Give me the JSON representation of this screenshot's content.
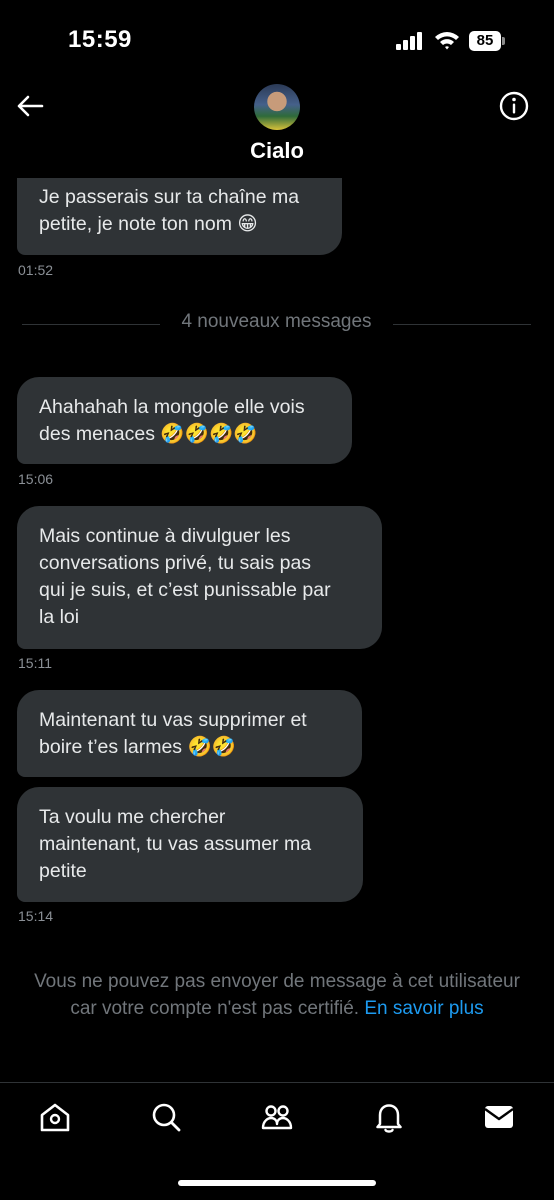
{
  "status_bar": {
    "time": "15:59",
    "battery_level": "85"
  },
  "header": {
    "contact_name": "Cialo"
  },
  "thread": {
    "messages": [
      {
        "lines": [
          "Je passerais sur ta chaîne ma",
          "petite, je note ton nom 😁"
        ],
        "timestamp": "01:52"
      },
      {
        "lines": [
          "Ahahahah la mongole elle vois",
          "des menaces 🤣🤣🤣🤣"
        ],
        "timestamp": "15:06"
      },
      {
        "lines": [
          "Mais continue à divulguer les",
          "conversations privé, tu sais pas",
          "qui je suis, et c’est punissable par",
          "la loi"
        ],
        "timestamp": "15:11"
      },
      {
        "lines": [
          "Maintenant tu vas supprimer et",
          "boire t’es larmes 🤣🤣"
        ]
      },
      {
        "lines": [
          "Ta voulu me chercher",
          "maintenant, tu vas assumer ma",
          "petite"
        ],
        "timestamp": "15:14"
      }
    ],
    "new_messages_divider": "4 nouveaux messages"
  },
  "notice": {
    "line1": "Vous ne pouvez pas envoyer de message à cet utilisateur",
    "line2": "car votre compte n'est pas certifié.",
    "link": "En savoir plus"
  },
  "bottom_nav": {
    "items": [
      "home-icon",
      "search-icon",
      "communities-icon",
      "notifications-icon",
      "messages-icon"
    ],
    "active": "messages-icon"
  },
  "colors": {
    "background": "#000000",
    "bubble": "#2f3336",
    "text_secondary": "#71767b",
    "link": "#1d9bf0"
  }
}
